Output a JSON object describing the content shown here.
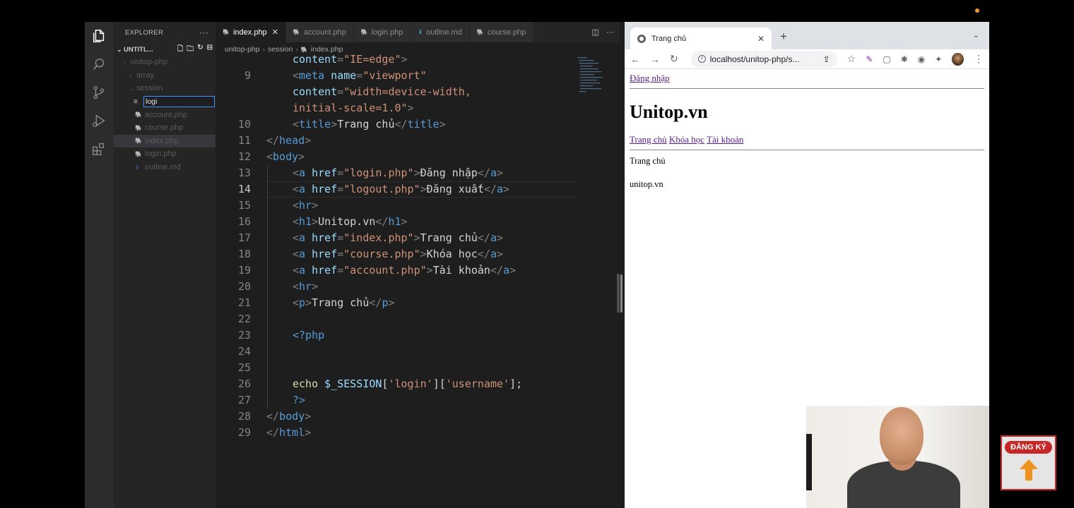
{
  "explorer": {
    "title": "EXPLORER",
    "workspace": "UNTITL...",
    "tree": [
      {
        "label": "unitop-php",
        "kind": "folder",
        "indent": 0,
        "chev": "›"
      },
      {
        "label": "array",
        "kind": "folder",
        "indent": 1,
        "chev": "›"
      },
      {
        "label": "session",
        "kind": "folder",
        "indent": 1,
        "chev": "⌄"
      },
      {
        "label": "account.php",
        "kind": "php",
        "indent": 2
      },
      {
        "label": "course.php",
        "kind": "php",
        "indent": 2
      },
      {
        "label": "index.php",
        "kind": "php",
        "indent": 2,
        "selected": true
      },
      {
        "label": "login.php",
        "kind": "php",
        "indent": 2
      },
      {
        "label": "outline.md",
        "kind": "md",
        "indent": 2
      }
    ],
    "new_file_value": "logi"
  },
  "tabs": [
    {
      "label": "index.php",
      "kind": "php",
      "active": true
    },
    {
      "label": "account.php",
      "kind": "php"
    },
    {
      "label": "login.php",
      "kind": "php"
    },
    {
      "label": "outline.md",
      "kind": "md"
    },
    {
      "label": "course.php",
      "kind": "php"
    }
  ],
  "breadcrumb": [
    "unitop-php",
    "session",
    "index.php"
  ],
  "code_lines": [
    {
      "n": "",
      "parts": [
        [
          "at",
          "content"
        ],
        [
          "pu",
          "="
        ],
        [
          "st",
          "\"IE=edge\""
        ],
        [
          "pu",
          ">"
        ]
      ]
    },
    {
      "n": "9",
      "parts": [
        [
          "pu",
          "<"
        ],
        [
          "tg",
          "meta"
        ],
        [
          "tx",
          " "
        ],
        [
          "at",
          "name"
        ],
        [
          "pu",
          "="
        ],
        [
          "st",
          "\"viewport\""
        ]
      ]
    },
    {
      "n": "",
      "parts": [
        [
          "at",
          "content"
        ],
        [
          "pu",
          "="
        ],
        [
          "st",
          "\"width=device-width,"
        ]
      ]
    },
    {
      "n": "",
      "parts": [
        [
          "st",
          "initial-scale=1.0\""
        ],
        [
          "pu",
          ">"
        ]
      ]
    },
    {
      "n": "10",
      "parts": [
        [
          "pu",
          "<"
        ],
        [
          "tg",
          "title"
        ],
        [
          "pu",
          ">"
        ],
        [
          "tx",
          "Trang chủ"
        ],
        [
          "pu",
          "</"
        ],
        [
          "tg",
          "title"
        ],
        [
          "pu",
          ">"
        ]
      ]
    },
    {
      "n": "11",
      "indent": 0,
      "parts": [
        [
          "pu",
          "</"
        ],
        [
          "tg",
          "head"
        ],
        [
          "pu",
          ">"
        ]
      ]
    },
    {
      "n": "12",
      "indent": 0,
      "parts": [
        [
          "pu",
          "<"
        ],
        [
          "tg",
          "body"
        ],
        [
          "pu",
          ">"
        ]
      ]
    },
    {
      "n": "13",
      "parts": [
        [
          "pu",
          "<"
        ],
        [
          "tg",
          "a"
        ],
        [
          "tx",
          " "
        ],
        [
          "at",
          "href"
        ],
        [
          "pu",
          "="
        ],
        [
          "st",
          "\"login.php\""
        ],
        [
          "pu",
          ">"
        ],
        [
          "tx",
          "Đăng nhập"
        ],
        [
          "pu",
          "</"
        ],
        [
          "tg",
          "a"
        ],
        [
          "pu",
          ">"
        ]
      ]
    },
    {
      "n": "14",
      "current": true,
      "parts": [
        [
          "pu",
          "<"
        ],
        [
          "tg",
          "a"
        ],
        [
          "tx",
          " "
        ],
        [
          "at",
          "href"
        ],
        [
          "pu",
          "="
        ],
        [
          "st",
          "\"logout.php\""
        ],
        [
          "pu",
          ">"
        ],
        [
          "tx",
          "Đăng xuất"
        ],
        [
          "pu",
          "</"
        ],
        [
          "tg",
          "a"
        ],
        [
          "pu",
          ">"
        ]
      ]
    },
    {
      "n": "15",
      "parts": [
        [
          "pu",
          "<"
        ],
        [
          "tg",
          "hr"
        ],
        [
          "pu",
          ">"
        ]
      ]
    },
    {
      "n": "16",
      "parts": [
        [
          "pu",
          "<"
        ],
        [
          "tg",
          "h1"
        ],
        [
          "pu",
          ">"
        ],
        [
          "tx",
          "Unitop.vn"
        ],
        [
          "pu",
          "</"
        ],
        [
          "tg",
          "h1"
        ],
        [
          "pu",
          ">"
        ]
      ]
    },
    {
      "n": "17",
      "parts": [
        [
          "pu",
          "<"
        ],
        [
          "tg",
          "a"
        ],
        [
          "tx",
          " "
        ],
        [
          "at",
          "href"
        ],
        [
          "pu",
          "="
        ],
        [
          "st",
          "\"index.php\""
        ],
        [
          "pu",
          ">"
        ],
        [
          "tx",
          "Trang chủ"
        ],
        [
          "pu",
          "</"
        ],
        [
          "tg",
          "a"
        ],
        [
          "pu",
          ">"
        ]
      ]
    },
    {
      "n": "18",
      "parts": [
        [
          "pu",
          "<"
        ],
        [
          "tg",
          "a"
        ],
        [
          "tx",
          " "
        ],
        [
          "at",
          "href"
        ],
        [
          "pu",
          "="
        ],
        [
          "st",
          "\"course.php\""
        ],
        [
          "pu",
          ">"
        ],
        [
          "tx",
          "Khóa học"
        ],
        [
          "pu",
          "</"
        ],
        [
          "tg",
          "a"
        ],
        [
          "pu",
          ">"
        ]
      ]
    },
    {
      "n": "19",
      "parts": [
        [
          "pu",
          "<"
        ],
        [
          "tg",
          "a"
        ],
        [
          "tx",
          " "
        ],
        [
          "at",
          "href"
        ],
        [
          "pu",
          "="
        ],
        [
          "st",
          "\"account.php\""
        ],
        [
          "pu",
          ">"
        ],
        [
          "tx",
          "Tài khoản"
        ],
        [
          "pu",
          "</"
        ],
        [
          "tg",
          "a"
        ],
        [
          "pu",
          ">"
        ]
      ]
    },
    {
      "n": "20",
      "parts": [
        [
          "pu",
          "<"
        ],
        [
          "tg",
          "hr"
        ],
        [
          "pu",
          ">"
        ]
      ]
    },
    {
      "n": "21",
      "parts": [
        [
          "pu",
          "<"
        ],
        [
          "tg",
          "p"
        ],
        [
          "pu",
          ">"
        ],
        [
          "tx",
          "Trang chủ"
        ],
        [
          "pu",
          "</"
        ],
        [
          "tg",
          "p"
        ],
        [
          "pu",
          ">"
        ]
      ]
    },
    {
      "n": "22",
      "parts": []
    },
    {
      "n": "23",
      "parts": [
        [
          "php",
          "<?php"
        ]
      ]
    },
    {
      "n": "24",
      "parts": []
    },
    {
      "n": "25",
      "parts": []
    },
    {
      "n": "26",
      "parts": [
        [
          "kw",
          "echo"
        ],
        [
          "tx",
          " "
        ],
        [
          "vr",
          "$_SESSION"
        ],
        [
          "tx",
          "["
        ],
        [
          "st",
          "'login'"
        ],
        [
          "tx",
          "]["
        ],
        [
          "st",
          "'username'"
        ],
        [
          "tx",
          "];"
        ]
      ]
    },
    {
      "n": "27",
      "parts": [
        [
          "php",
          "?>"
        ]
      ]
    },
    {
      "n": "28",
      "indent": 0,
      "parts": [
        [
          "pu",
          "</"
        ],
        [
          "tg",
          "body"
        ],
        [
          "pu",
          ">"
        ]
      ]
    },
    {
      "n": "29",
      "indent": 0,
      "parts": [
        [
          "pu",
          "</"
        ],
        [
          "tg",
          "html"
        ],
        [
          "pu",
          ">"
        ]
      ]
    }
  ],
  "browser": {
    "tab_title": "Trang chủ",
    "url": "localhost/unitop-php/s...",
    "page": {
      "login_link": "Đăng nhập",
      "heading": "Unitop.vn",
      "nav": [
        "Trang chủ",
        "Khóa học",
        "Tài khoản"
      ],
      "paragraph": "Trang chủ",
      "echo_output": "unitop.vn"
    }
  },
  "subscribe": {
    "label": "ĐĂNG KÝ",
    "color": "#c62828",
    "arrow_color": "#f0931e"
  },
  "colors": {
    "editor_bg": "#1e1e1e",
    "sidebar_bg": "#252526",
    "tag": "#569cd6",
    "string": "#ce9178",
    "attr": "#9cdcfe"
  }
}
